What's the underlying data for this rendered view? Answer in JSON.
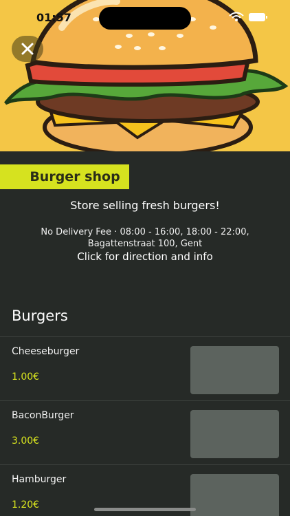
{
  "status_bar": {
    "time": "01:57"
  },
  "header": {
    "close_icon": "close-icon",
    "hero_image": "burger illustration"
  },
  "shop": {
    "name": "Burger shop",
    "tagline": "Store selling fresh burgers!",
    "info_line_1": "No Delivery Fee · 08:00 - 16:00, 18:00 - 22:00,",
    "info_line_2": "Bagattenstraat 100, Gent",
    "direction_link": "Click for direction and info"
  },
  "menu": {
    "section_title": "Burgers",
    "items": [
      {
        "name": "Cheeseburger",
        "price": "1.00€"
      },
      {
        "name": "BaconBurger",
        "price": "3.00€"
      },
      {
        "name": "Hamburger",
        "price": "1.20€"
      }
    ]
  },
  "colors": {
    "accent": "#d6e21f",
    "background": "#262a27",
    "hero_bg": "#f4c646",
    "thumb": "#5c635e"
  }
}
